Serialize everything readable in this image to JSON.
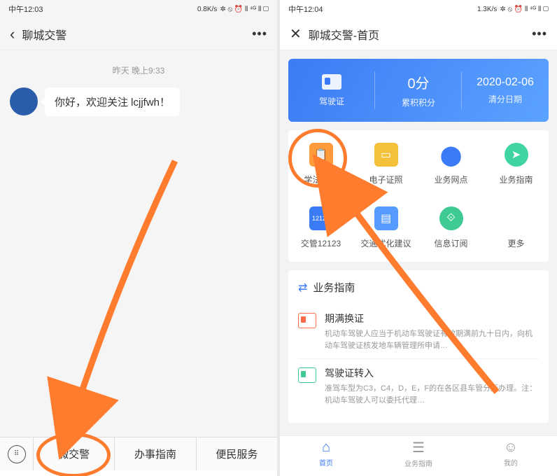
{
  "left": {
    "status": {
      "time": "中午12:03",
      "net": "0.8K/s",
      "icons": "✲ ⦸ ⏰ ⫴ ⁴ᴳ ⫴ ▢"
    },
    "header": {
      "title": "聊城交警"
    },
    "timestamp": "昨天 晚上9:33",
    "message": "你好，欢迎关注 lcjjfwh！",
    "menu": {
      "item1": "微交警",
      "item2": "办事指南",
      "item3": "便民服务"
    }
  },
  "right": {
    "status": {
      "time": "中午12:04",
      "net": "1.3K/s",
      "icons": "✲ ⦸ ⏰ ⫴ ⁴ᴳ ⫴ ▢"
    },
    "header": {
      "title": "聊城交警-首页"
    },
    "card": {
      "license_label": "驾驶证",
      "score": "0分",
      "score_label": "累积积分",
      "date": "2020-02-06",
      "date_label": "清分日期"
    },
    "grid": [
      {
        "label": "学法积分"
      },
      {
        "label": "电子证照"
      },
      {
        "label": "业务网点"
      },
      {
        "label": "业务指南"
      },
      {
        "label": "交管12123"
      },
      {
        "label": "交通优化建议"
      },
      {
        "label": "信息订阅"
      },
      {
        "label": "更多"
      }
    ],
    "guide": {
      "section_title": "业务指南",
      "items": [
        {
          "title": "期满换证",
          "desc": "机动车驾驶人应当于机动车驾驶证有效期满前九十日内，向机动车驾驶证核发地车辆管理所申请…"
        },
        {
          "title": "驾驶证转入",
          "desc": "准驾车型为C3，C4，D，E，F的在各区县车管分所办理。注：机动车驾驶人可以委托代理…"
        }
      ]
    },
    "tabs": {
      "home": "首页",
      "guide": "业务指南",
      "mine": "我的"
    }
  }
}
